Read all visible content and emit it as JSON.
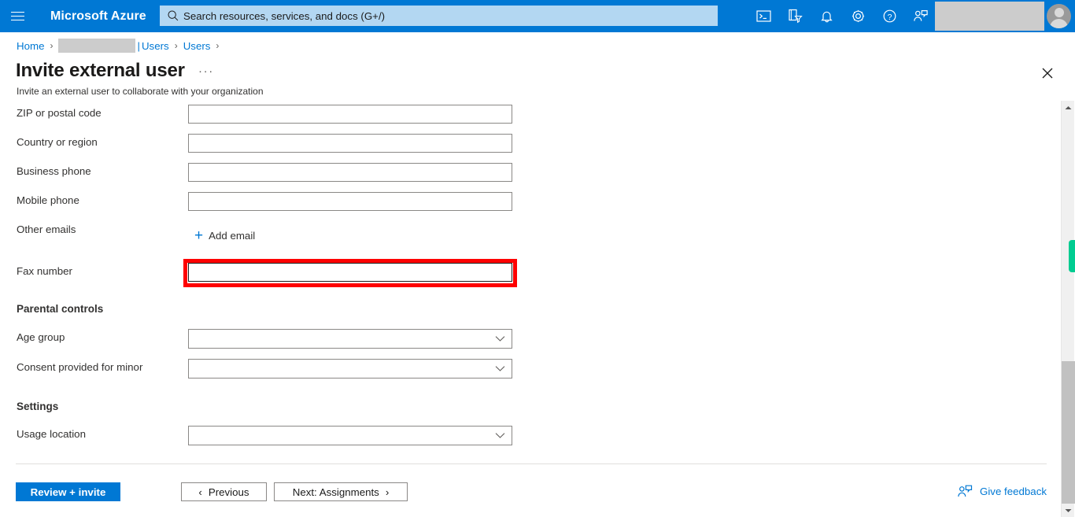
{
  "header": {
    "brand": "Microsoft Azure",
    "menu_icon": "hamburger-icon",
    "search": {
      "placeholder": "Search resources, services, and docs (G+/)",
      "value": ""
    },
    "icons": [
      {
        "name": "cloud-shell-icon",
        "label": "Cloud Shell"
      },
      {
        "name": "directory-filter-icon",
        "label": "Directories + subscriptions"
      },
      {
        "name": "notifications-bell-icon",
        "label": "Notifications"
      },
      {
        "name": "settings-gear-icon",
        "label": "Settings"
      },
      {
        "name": "help-question-icon",
        "label": "Help"
      },
      {
        "name": "feedback-person-icon",
        "label": "Feedback"
      }
    ],
    "account_redacted": "",
    "avatar": "user-avatar"
  },
  "breadcrumb": {
    "home": "Home",
    "redacted": "",
    "pipe": "|",
    "item2": "Users",
    "item3": "Users",
    "separator": "›"
  },
  "page": {
    "title": "Invite external user",
    "ellipsis": "···",
    "subtitle": "Invite an external user to collaborate with your organization",
    "close_label": "✕"
  },
  "form": {
    "fields": [
      {
        "label": "ZIP or postal code",
        "value": "",
        "type": "text"
      },
      {
        "label": "Country or region",
        "value": "",
        "type": "text"
      },
      {
        "label": "Business phone",
        "value": "",
        "type": "text"
      },
      {
        "label": "Mobile phone",
        "value": "",
        "type": "text"
      }
    ],
    "other_emails_label": "Other emails",
    "add_email_label": "Add email",
    "add_email_plus": "+",
    "fax_label": "Fax number",
    "fax_value": "",
    "parental_controls_heading": "Parental controls",
    "age_group_label": "Age group",
    "age_group_value": "",
    "consent_label": "Consent provided for minor",
    "consent_value": "",
    "settings_heading": "Settings",
    "usage_location_label": "Usage location",
    "usage_location_value": ""
  },
  "footer": {
    "review_invite": "Review + invite",
    "previous": "Previous",
    "previous_chevron": "‹",
    "next": "Next: Assignments",
    "next_chevron": "›",
    "give_feedback": "Give feedback"
  },
  "colors": {
    "azure_blue": "#0078d4",
    "search_bg": "#b3d7f2",
    "highlight_red": "#fe0000",
    "green_tab": "#00cc91",
    "border_gray": "#8a8886"
  }
}
